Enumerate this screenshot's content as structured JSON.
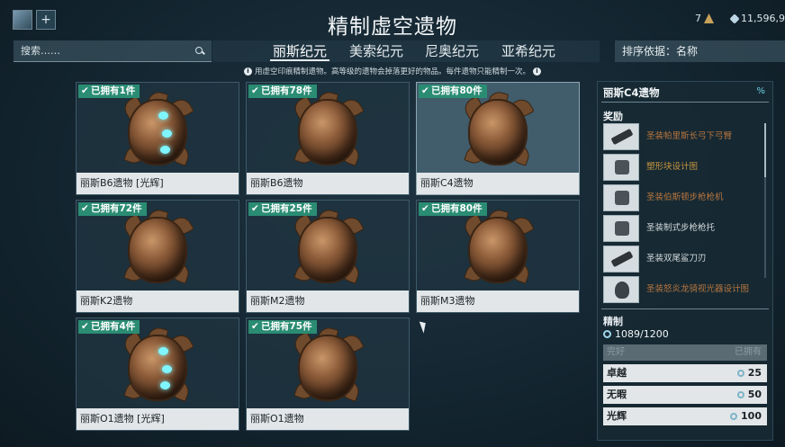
{
  "header": {
    "title": "精制虚空遗物",
    "endo": "7",
    "credits": "11,596,9"
  },
  "search": {
    "placeholder": "搜索……"
  },
  "tabs": [
    "丽斯纪元",
    "美索纪元",
    "尼奥纪元",
    "亚希纪元"
  ],
  "sort": {
    "label": "排序依据：名称"
  },
  "info": "用虚空印痕精制遗物。高等级的遗物会掉落更好的物品。每件遗物只能精制一次。",
  "relics": [
    {
      "owned": "已拥有1件",
      "name": "丽斯B6遗物 [光辉]",
      "radiant": true
    },
    {
      "owned": "已拥有78件",
      "name": "丽斯B6遗物",
      "radiant": false
    },
    {
      "owned": "已拥有80件",
      "name": "丽斯C4遗物",
      "radiant": false
    },
    {
      "owned": "已拥有72件",
      "name": "丽斯K2遗物",
      "radiant": false
    },
    {
      "owned": "已拥有25件",
      "name": "丽斯M2遗物",
      "radiant": false
    },
    {
      "owned": "已拥有80件",
      "name": "丽斯M3遗物",
      "radiant": false
    },
    {
      "owned": "已拥有4件",
      "name": "丽斯O1遗物 [光辉]",
      "radiant": true
    },
    {
      "owned": "已拥有75件",
      "name": "丽斯O1遗物",
      "radiant": false
    }
  ],
  "panel": {
    "title": "丽斯C4遗物",
    "percent_icon": "%",
    "rewards_heading": "奖励",
    "rewards": [
      {
        "name": "圣装帕里斯长弓下弓臂",
        "rarity": "bronze",
        "icon": "bow-part-icon"
      },
      {
        "name": "塑形块设计图",
        "rarity": "gold",
        "icon": "formablock-icon"
      },
      {
        "name": "圣装伯斯顿步枪枪机",
        "rarity": "bronze",
        "icon": "receiver-icon"
      },
      {
        "name": "圣装制式步枪枪托",
        "rarity": "silver",
        "icon": "stock-icon"
      },
      {
        "name": "圣装双尾鲨刀刃",
        "rarity": "silver",
        "icon": "blade-icon"
      },
      {
        "name": "圣装怒炎龙骑视光器设计图",
        "rarity": "bronze",
        "icon": "helmet-icon"
      }
    ],
    "refine_heading": "精制",
    "void_traces": "1089/1200",
    "refine_header_left": "完好",
    "refine_header_right": "已拥有",
    "refine_options": [
      {
        "label": "卓越",
        "cost": "25"
      },
      {
        "label": "无暇",
        "cost": "50"
      },
      {
        "label": "光辉",
        "cost": "100"
      }
    ]
  }
}
